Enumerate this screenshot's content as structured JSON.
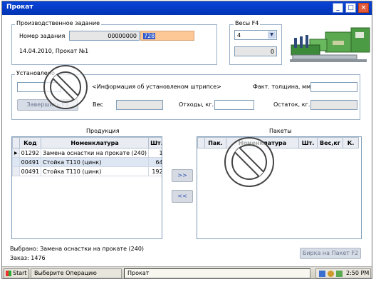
{
  "window": {
    "title": "Прокат",
    "min": "_",
    "max": "□",
    "close": "×"
  },
  "order": {
    "group_title": "Производственное задание",
    "number_label": "Номер задания",
    "number_value": "00000000",
    "number_suffix": "728",
    "date_line": "14.04.2010, Прокат №1"
  },
  "scales": {
    "group_title": "Весы  F4",
    "selected": "4",
    "weight_value": "0"
  },
  "installed": {
    "group_title": "Установлено",
    "strip_info": "<Информация об установленом штрипсе>",
    "actual_thickness_label": "Факт. толщина, мм.",
    "register_button": "Завершить   F1",
    "weight_label": "Вес",
    "waste_label": "Отходы, кг.",
    "remainder_label": "Остаток, кг."
  },
  "products": {
    "title": "Продукция",
    "columns": [
      "Код",
      "Номенклатура",
      "Шт."
    ],
    "rows": [
      {
        "code": "01292",
        "name": "Замена оснастки на прокате (240)",
        "qty": "1"
      },
      {
        "code": "00491",
        "name": "Стойка Т110 (цинк)",
        "qty": "64"
      },
      {
        "code": "00491",
        "name": "Стойка Т110 (цинк)",
        "qty": "192"
      }
    ]
  },
  "packages": {
    "title": "Пакеты",
    "columns": [
      "Пак.",
      "Номенклатура",
      "Шт.",
      "Вес,кг",
      "К."
    ]
  },
  "move_right": ">>",
  "move_left": "<<",
  "footer": {
    "selected": "Выбрано: Замена оснастки на прокате (240)",
    "order": "Заказ: 1476",
    "tag_button": "Бирка на Пакет  F2"
  },
  "taskbar": {
    "start": "Start",
    "task1": "Выберите Операцию",
    "task2": "Прокат",
    "clock": "2:50 PM"
  }
}
